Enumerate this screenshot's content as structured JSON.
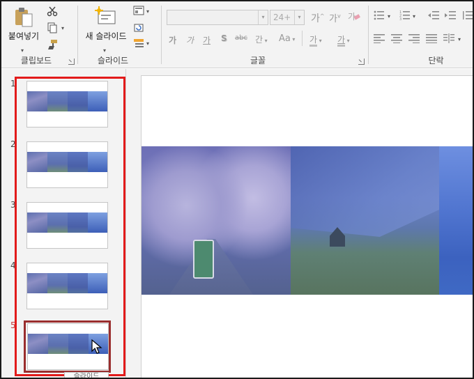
{
  "ribbon": {
    "clipboard": {
      "paste_label": "붙여넣기",
      "group_label": "클립보드",
      "icons": [
        "paste-icon",
        "cut-icon",
        "copy-icon",
        "format-painter-icon"
      ]
    },
    "slides": {
      "new_slide_label": "새 슬라이드",
      "group_label": "슬라이드",
      "icons": [
        "new-slide-icon",
        "layout-icon",
        "reset-icon",
        "section-icon"
      ]
    },
    "font": {
      "font_name_value": "",
      "font_size_value": "24+",
      "grow_label": "가",
      "shrink_label": "가",
      "clear_label": "가",
      "bold_label": "가",
      "italic_label": "가",
      "underline_label": "가",
      "shadow_label": "S",
      "strike_label": "abc",
      "spacing_label": "간",
      "case_label": "Aa",
      "highlight_label": "가",
      "color_label": "가",
      "group_label": "글꼴"
    },
    "paragraph": {
      "group_label": "단락"
    }
  },
  "thumbnails": {
    "numbers": [
      "1",
      "2",
      "3",
      "4",
      "5"
    ],
    "tooltip": "슬라이드"
  },
  "colors": {
    "highlight_box": "#e21a1a",
    "selected_box": "#9a2e2e",
    "ribbon_bg": "#f3f3f3"
  }
}
